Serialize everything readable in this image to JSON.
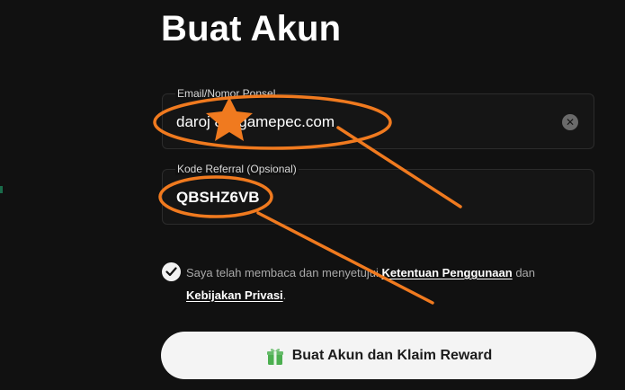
{
  "form": {
    "title": "Buat Akun",
    "email": {
      "label": "Email/Nomor Ponsel",
      "value": "daroj        8@gamepec.com"
    },
    "referral": {
      "label": "Kode Referral (Opsional)",
      "value": "QBSHZ6VB"
    },
    "terms": {
      "checked": true,
      "prefix": "Saya telah membaca dan menyetujui ",
      "link1": "Ketentuan Penggunaan",
      "middle": " dan",
      "link2": "Kebijakan Privasi",
      "suffix": "."
    },
    "submit_label": "Buat Akun dan Klaim Reward",
    "submit_icon": "gift-icon"
  },
  "annotation_color": "#f07a1f",
  "accent_color": "#1a6b4a"
}
